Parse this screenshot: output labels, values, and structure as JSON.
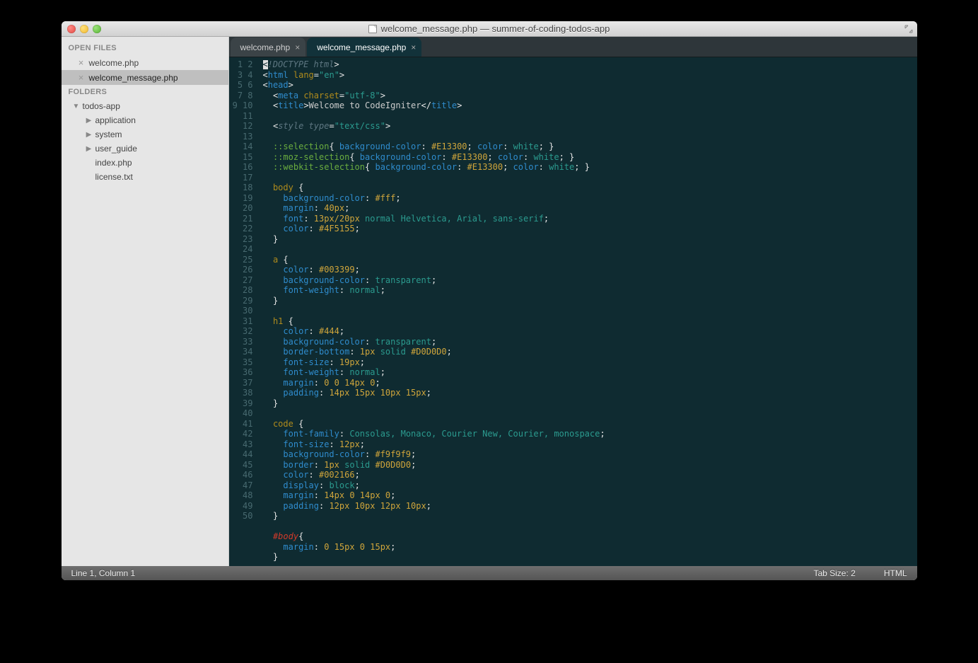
{
  "window": {
    "title": "welcome_message.php — summer-of-coding-todos-app"
  },
  "sidebar": {
    "open_files_header": "OPEN FILES",
    "open_files": [
      {
        "name": "welcome.php",
        "selected": false
      },
      {
        "name": "welcome_message.php",
        "selected": true
      }
    ],
    "folders_header": "FOLDERS",
    "root": {
      "name": "todos-app",
      "expanded": true
    },
    "children": [
      {
        "name": "application",
        "type": "folder"
      },
      {
        "name": "system",
        "type": "folder"
      },
      {
        "name": "user_guide",
        "type": "folder"
      },
      {
        "name": "index.php",
        "type": "file"
      },
      {
        "name": "license.txt",
        "type": "file"
      }
    ]
  },
  "tabs": [
    {
      "label": "welcome.php",
      "active": false
    },
    {
      "label": "welcome_message.php",
      "active": true
    }
  ],
  "code_lines": [
    [
      {
        "cursor": true,
        "t": "<"
      },
      {
        "cls": "c-doctype",
        "t": "!DOCTYPE html"
      },
      {
        "cls": "c-punc",
        "t": ">"
      }
    ],
    [
      {
        "cls": "c-punc",
        "t": "<"
      },
      {
        "cls": "c-tag",
        "t": "html"
      },
      {
        "t": " "
      },
      {
        "cls": "c-attr",
        "t": "lang"
      },
      {
        "cls": "c-punc",
        "t": "="
      },
      {
        "cls": "c-str",
        "t": "\"en\""
      },
      {
        "cls": "c-punc",
        "t": ">"
      }
    ],
    [
      {
        "cls": "c-punc",
        "t": "<"
      },
      {
        "cls": "c-tag",
        "t": "head"
      },
      {
        "cls": "c-punc",
        "t": ">"
      }
    ],
    [
      {
        "t": "  "
      },
      {
        "cls": "c-punc",
        "t": "<"
      },
      {
        "cls": "c-tag",
        "t": "meta"
      },
      {
        "t": " "
      },
      {
        "cls": "c-attr",
        "t": "charset"
      },
      {
        "cls": "c-punc",
        "t": "="
      },
      {
        "cls": "c-str",
        "t": "\"utf-8\""
      },
      {
        "cls": "c-punc",
        "t": ">"
      }
    ],
    [
      {
        "t": "  "
      },
      {
        "cls": "c-punc",
        "t": "<"
      },
      {
        "cls": "c-tag",
        "t": "title"
      },
      {
        "cls": "c-punc",
        "t": ">"
      },
      {
        "t": "Welcome to CodeIgniter"
      },
      {
        "cls": "c-punc",
        "t": "</"
      },
      {
        "cls": "c-tag",
        "t": "title"
      },
      {
        "cls": "c-punc",
        "t": ">"
      }
    ],
    [],
    [
      {
        "t": "  "
      },
      {
        "cls": "c-punc",
        "t": "<"
      },
      {
        "cls": "c-style-tag",
        "t": "style"
      },
      {
        "t": " "
      },
      {
        "cls": "c-style-tag",
        "t": "type"
      },
      {
        "cls": "c-punc",
        "t": "="
      },
      {
        "cls": "c-str",
        "t": "\"text/css\""
      },
      {
        "cls": "c-punc",
        "t": ">"
      }
    ],
    [],
    [
      {
        "t": "  "
      },
      {
        "cls": "c-selpsd",
        "t": "::selection"
      },
      {
        "cls": "c-br",
        "t": "{"
      },
      {
        "t": " "
      },
      {
        "cls": "c-prop",
        "t": "background-color"
      },
      {
        "cls": "c-punc",
        "t": ": "
      },
      {
        "cls": "c-num",
        "t": "#E13300"
      },
      {
        "cls": "c-punc",
        "t": "; "
      },
      {
        "cls": "c-prop",
        "t": "color"
      },
      {
        "cls": "c-punc",
        "t": ": "
      },
      {
        "cls": "c-val",
        "t": "white"
      },
      {
        "cls": "c-punc",
        "t": "; "
      },
      {
        "cls": "c-br",
        "t": "}"
      }
    ],
    [
      {
        "t": "  "
      },
      {
        "cls": "c-selpsd",
        "t": "::moz-selection"
      },
      {
        "cls": "c-br",
        "t": "{"
      },
      {
        "t": " "
      },
      {
        "cls": "c-prop",
        "t": "background-color"
      },
      {
        "cls": "c-punc",
        "t": ": "
      },
      {
        "cls": "c-num",
        "t": "#E13300"
      },
      {
        "cls": "c-punc",
        "t": "; "
      },
      {
        "cls": "c-prop",
        "t": "color"
      },
      {
        "cls": "c-punc",
        "t": ": "
      },
      {
        "cls": "c-val",
        "t": "white"
      },
      {
        "cls": "c-punc",
        "t": "; "
      },
      {
        "cls": "c-br",
        "t": "}"
      }
    ],
    [
      {
        "t": "  "
      },
      {
        "cls": "c-selpsd",
        "t": "::webkit-selection"
      },
      {
        "cls": "c-br",
        "t": "{"
      },
      {
        "t": " "
      },
      {
        "cls": "c-prop",
        "t": "background-color"
      },
      {
        "cls": "c-punc",
        "t": ": "
      },
      {
        "cls": "c-num",
        "t": "#E13300"
      },
      {
        "cls": "c-punc",
        "t": "; "
      },
      {
        "cls": "c-prop",
        "t": "color"
      },
      {
        "cls": "c-punc",
        "t": ": "
      },
      {
        "cls": "c-val",
        "t": "white"
      },
      {
        "cls": "c-punc",
        "t": "; "
      },
      {
        "cls": "c-br",
        "t": "}"
      }
    ],
    [],
    [
      {
        "t": "  "
      },
      {
        "cls": "c-sel",
        "t": "body"
      },
      {
        "t": " "
      },
      {
        "cls": "c-br",
        "t": "{"
      }
    ],
    [
      {
        "t": "    "
      },
      {
        "cls": "c-prop",
        "t": "background-color"
      },
      {
        "cls": "c-punc",
        "t": ": "
      },
      {
        "cls": "c-num",
        "t": "#fff"
      },
      {
        "cls": "c-punc",
        "t": ";"
      }
    ],
    [
      {
        "t": "    "
      },
      {
        "cls": "c-prop",
        "t": "margin"
      },
      {
        "cls": "c-punc",
        "t": ": "
      },
      {
        "cls": "c-num",
        "t": "40px"
      },
      {
        "cls": "c-punc",
        "t": ";"
      }
    ],
    [
      {
        "t": "    "
      },
      {
        "cls": "c-prop",
        "t": "font"
      },
      {
        "cls": "c-punc",
        "t": ": "
      },
      {
        "cls": "c-num",
        "t": "13px/20px"
      },
      {
        "t": " "
      },
      {
        "cls": "c-val",
        "t": "normal"
      },
      {
        "t": " "
      },
      {
        "cls": "c-val",
        "t": "Helvetica, Arial, sans-serif"
      },
      {
        "cls": "c-punc",
        "t": ";"
      }
    ],
    [
      {
        "t": "    "
      },
      {
        "cls": "c-prop",
        "t": "color"
      },
      {
        "cls": "c-punc",
        "t": ": "
      },
      {
        "cls": "c-num",
        "t": "#4F5155"
      },
      {
        "cls": "c-punc",
        "t": ";"
      }
    ],
    [
      {
        "t": "  "
      },
      {
        "cls": "c-br",
        "t": "}"
      }
    ],
    [],
    [
      {
        "t": "  "
      },
      {
        "cls": "c-sel",
        "t": "a"
      },
      {
        "t": " "
      },
      {
        "cls": "c-br",
        "t": "{"
      }
    ],
    [
      {
        "t": "    "
      },
      {
        "cls": "c-prop",
        "t": "color"
      },
      {
        "cls": "c-punc",
        "t": ": "
      },
      {
        "cls": "c-num",
        "t": "#003399"
      },
      {
        "cls": "c-punc",
        "t": ";"
      }
    ],
    [
      {
        "t": "    "
      },
      {
        "cls": "c-prop",
        "t": "background-color"
      },
      {
        "cls": "c-punc",
        "t": ": "
      },
      {
        "cls": "c-val",
        "t": "transparent"
      },
      {
        "cls": "c-punc",
        "t": ";"
      }
    ],
    [
      {
        "t": "    "
      },
      {
        "cls": "c-prop",
        "t": "font-weight"
      },
      {
        "cls": "c-punc",
        "t": ": "
      },
      {
        "cls": "c-val",
        "t": "normal"
      },
      {
        "cls": "c-punc",
        "t": ";"
      }
    ],
    [
      {
        "t": "  "
      },
      {
        "cls": "c-br",
        "t": "}"
      }
    ],
    [],
    [
      {
        "t": "  "
      },
      {
        "cls": "c-sel",
        "t": "h1"
      },
      {
        "t": " "
      },
      {
        "cls": "c-br",
        "t": "{"
      }
    ],
    [
      {
        "t": "    "
      },
      {
        "cls": "c-prop",
        "t": "color"
      },
      {
        "cls": "c-punc",
        "t": ": "
      },
      {
        "cls": "c-num",
        "t": "#444"
      },
      {
        "cls": "c-punc",
        "t": ";"
      }
    ],
    [
      {
        "t": "    "
      },
      {
        "cls": "c-prop",
        "t": "background-color"
      },
      {
        "cls": "c-punc",
        "t": ": "
      },
      {
        "cls": "c-val",
        "t": "transparent"
      },
      {
        "cls": "c-punc",
        "t": ";"
      }
    ],
    [
      {
        "t": "    "
      },
      {
        "cls": "c-prop",
        "t": "border-bottom"
      },
      {
        "cls": "c-punc",
        "t": ": "
      },
      {
        "cls": "c-num",
        "t": "1px"
      },
      {
        "t": " "
      },
      {
        "cls": "c-val",
        "t": "solid"
      },
      {
        "t": " "
      },
      {
        "cls": "c-num",
        "t": "#D0D0D0"
      },
      {
        "cls": "c-punc",
        "t": ";"
      }
    ],
    [
      {
        "t": "    "
      },
      {
        "cls": "c-prop",
        "t": "font-size"
      },
      {
        "cls": "c-punc",
        "t": ": "
      },
      {
        "cls": "c-num",
        "t": "19px"
      },
      {
        "cls": "c-punc",
        "t": ";"
      }
    ],
    [
      {
        "t": "    "
      },
      {
        "cls": "c-prop",
        "t": "font-weight"
      },
      {
        "cls": "c-punc",
        "t": ": "
      },
      {
        "cls": "c-val",
        "t": "normal"
      },
      {
        "cls": "c-punc",
        "t": ";"
      }
    ],
    [
      {
        "t": "    "
      },
      {
        "cls": "c-prop",
        "t": "margin"
      },
      {
        "cls": "c-punc",
        "t": ": "
      },
      {
        "cls": "c-num",
        "t": "0 0 14px 0"
      },
      {
        "cls": "c-punc",
        "t": ";"
      }
    ],
    [
      {
        "t": "    "
      },
      {
        "cls": "c-prop",
        "t": "padding"
      },
      {
        "cls": "c-punc",
        "t": ": "
      },
      {
        "cls": "c-num",
        "t": "14px 15px 10px 15px"
      },
      {
        "cls": "c-punc",
        "t": ";"
      }
    ],
    [
      {
        "t": "  "
      },
      {
        "cls": "c-br",
        "t": "}"
      }
    ],
    [],
    [
      {
        "t": "  "
      },
      {
        "cls": "c-sel",
        "t": "code"
      },
      {
        "t": " "
      },
      {
        "cls": "c-br",
        "t": "{"
      }
    ],
    [
      {
        "t": "    "
      },
      {
        "cls": "c-prop",
        "t": "font-family"
      },
      {
        "cls": "c-punc",
        "t": ": "
      },
      {
        "cls": "c-val",
        "t": "Consolas, Monaco, Courier New, Courier, monospace"
      },
      {
        "cls": "c-punc",
        "t": ";"
      }
    ],
    [
      {
        "t": "    "
      },
      {
        "cls": "c-prop",
        "t": "font-size"
      },
      {
        "cls": "c-punc",
        "t": ": "
      },
      {
        "cls": "c-num",
        "t": "12px"
      },
      {
        "cls": "c-punc",
        "t": ";"
      }
    ],
    [
      {
        "t": "    "
      },
      {
        "cls": "c-prop",
        "t": "background-color"
      },
      {
        "cls": "c-punc",
        "t": ": "
      },
      {
        "cls": "c-num",
        "t": "#f9f9f9"
      },
      {
        "cls": "c-punc",
        "t": ";"
      }
    ],
    [
      {
        "t": "    "
      },
      {
        "cls": "c-prop",
        "t": "border"
      },
      {
        "cls": "c-punc",
        "t": ": "
      },
      {
        "cls": "c-num",
        "t": "1px"
      },
      {
        "t": " "
      },
      {
        "cls": "c-val",
        "t": "solid"
      },
      {
        "t": " "
      },
      {
        "cls": "c-num",
        "t": "#D0D0D0"
      },
      {
        "cls": "c-punc",
        "t": ";"
      }
    ],
    [
      {
        "t": "    "
      },
      {
        "cls": "c-prop",
        "t": "color"
      },
      {
        "cls": "c-punc",
        "t": ": "
      },
      {
        "cls": "c-num",
        "t": "#002166"
      },
      {
        "cls": "c-punc",
        "t": ";"
      }
    ],
    [
      {
        "t": "    "
      },
      {
        "cls": "c-prop",
        "t": "display"
      },
      {
        "cls": "c-punc",
        "t": ": "
      },
      {
        "cls": "c-val",
        "t": "block"
      },
      {
        "cls": "c-punc",
        "t": ";"
      }
    ],
    [
      {
        "t": "    "
      },
      {
        "cls": "c-prop",
        "t": "margin"
      },
      {
        "cls": "c-punc",
        "t": ": "
      },
      {
        "cls": "c-num",
        "t": "14px 0 14px 0"
      },
      {
        "cls": "c-punc",
        "t": ";"
      }
    ],
    [
      {
        "t": "    "
      },
      {
        "cls": "c-prop",
        "t": "padding"
      },
      {
        "cls": "c-punc",
        "t": ": "
      },
      {
        "cls": "c-num",
        "t": "12px 10px 12px 10px"
      },
      {
        "cls": "c-punc",
        "t": ";"
      }
    ],
    [
      {
        "t": "  "
      },
      {
        "cls": "c-br",
        "t": "}"
      }
    ],
    [],
    [
      {
        "t": "  "
      },
      {
        "cls": "c-id",
        "t": "#body"
      },
      {
        "cls": "c-br",
        "t": "{"
      }
    ],
    [
      {
        "t": "    "
      },
      {
        "cls": "c-prop",
        "t": "margin"
      },
      {
        "cls": "c-punc",
        "t": ": "
      },
      {
        "cls": "c-num",
        "t": "0 15px 0 15px"
      },
      {
        "cls": "c-punc",
        "t": ";"
      }
    ],
    [
      {
        "t": "  "
      },
      {
        "cls": "c-br",
        "t": "}"
      }
    ],
    [
      {
        "t": "  "
      }
    ]
  ],
  "status": {
    "position": "Line 1, Column 1",
    "tab_size": "Tab Size: 2",
    "syntax": "HTML"
  }
}
